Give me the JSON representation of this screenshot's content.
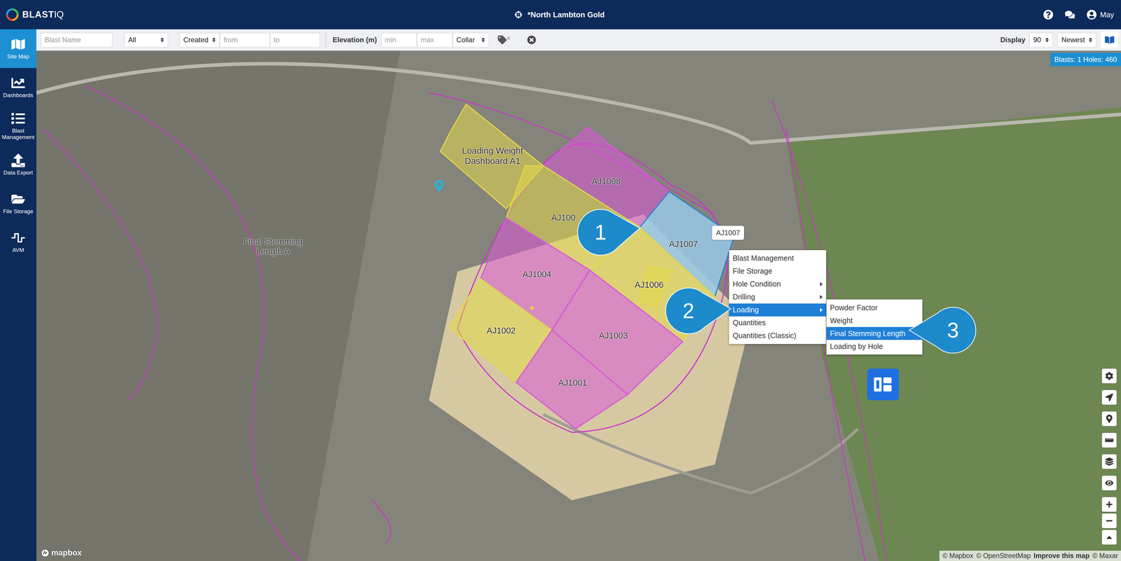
{
  "app": {
    "logo": {
      "brand": "BLAST",
      "suffix": "IQ"
    },
    "site": "*North Lambton Gold",
    "user": "May"
  },
  "sidebar": {
    "items": [
      {
        "label": "Site Map",
        "selected": true
      },
      {
        "label": "Dashboards",
        "selected": false
      },
      {
        "label": "Blast Management",
        "selected": false
      },
      {
        "label": "Data Export",
        "selected": false
      },
      {
        "label": "File Storage",
        "selected": false
      },
      {
        "label": "AVM",
        "selected": false
      }
    ]
  },
  "filters": {
    "blast_name": {
      "placeholder": "Blast Name"
    },
    "status": "All",
    "date_field": "Created",
    "from": {
      "placeholder": "from"
    },
    "to": {
      "placeholder": "to"
    },
    "elevation": {
      "label": "Elevation (m)",
      "min": {
        "placeholder": "min"
      },
      "max": {
        "placeholder": "max"
      },
      "reference": "Collar"
    },
    "tags": {
      "count": "0"
    },
    "display": {
      "label": "Display",
      "count": "90",
      "order": "Newest"
    }
  },
  "map": {
    "summary": "Blasts: 1 Holes: 460",
    "blasts": [
      {
        "name": "Loading Weight Dashboard A1",
        "color": "#e3d84a",
        "selected": false
      },
      {
        "name": "AJ1008",
        "color": "#d957d9",
        "selected": false
      },
      {
        "name": "AJ100",
        "color": "#e3d84a",
        "selected": false
      },
      {
        "name": "AJ1007",
        "color": "#d957d9",
        "selected": true
      },
      {
        "name": "AJ1004",
        "color": "#d957d9",
        "selected": false
      },
      {
        "name": "AJ1006",
        "color": "#e3d84a",
        "selected": false
      },
      {
        "name": "AJ1003",
        "color": "#d957d9",
        "selected": false
      },
      {
        "name": "AJ1002",
        "color": "#e3d84a",
        "selected": false
      },
      {
        "name": "AJ1001",
        "color": "#d957d9",
        "selected": false
      }
    ],
    "labels": [
      {
        "text": "Final Stemming Length A"
      }
    ],
    "tooltip": "AJ1007",
    "attribution": {
      "logo": "mapbox",
      "credits": [
        {
          "text": "© Mapbox",
          "link": false
        },
        {
          "text": "© OpenStreetMap",
          "link": false
        },
        {
          "text": "Improve this map",
          "link": true
        },
        {
          "text": "© Maxar",
          "link": false
        }
      ]
    }
  },
  "context_menu": {
    "items": [
      {
        "label": "Blast Management",
        "submenu": false,
        "selected": false
      },
      {
        "label": "File Storage",
        "submenu": false,
        "selected": false
      },
      {
        "label": "Hole Condition",
        "submenu": true,
        "selected": false
      },
      {
        "label": "Drilling",
        "submenu": true,
        "selected": false
      },
      {
        "label": "Loading",
        "submenu": true,
        "selected": true
      },
      {
        "label": "Quantities",
        "submenu": false,
        "selected": false
      },
      {
        "label": "Quantities (Classic)",
        "submenu": false,
        "selected": false
      }
    ],
    "submenu": {
      "items": [
        {
          "label": "Powder Factor",
          "selected": false
        },
        {
          "label": "Weight",
          "selected": false
        },
        {
          "label": "Final Stemming Length",
          "selected": true
        },
        {
          "label": "Loading by Hole",
          "selected": false
        }
      ]
    }
  },
  "callouts": [
    "1",
    "2",
    "3"
  ]
}
